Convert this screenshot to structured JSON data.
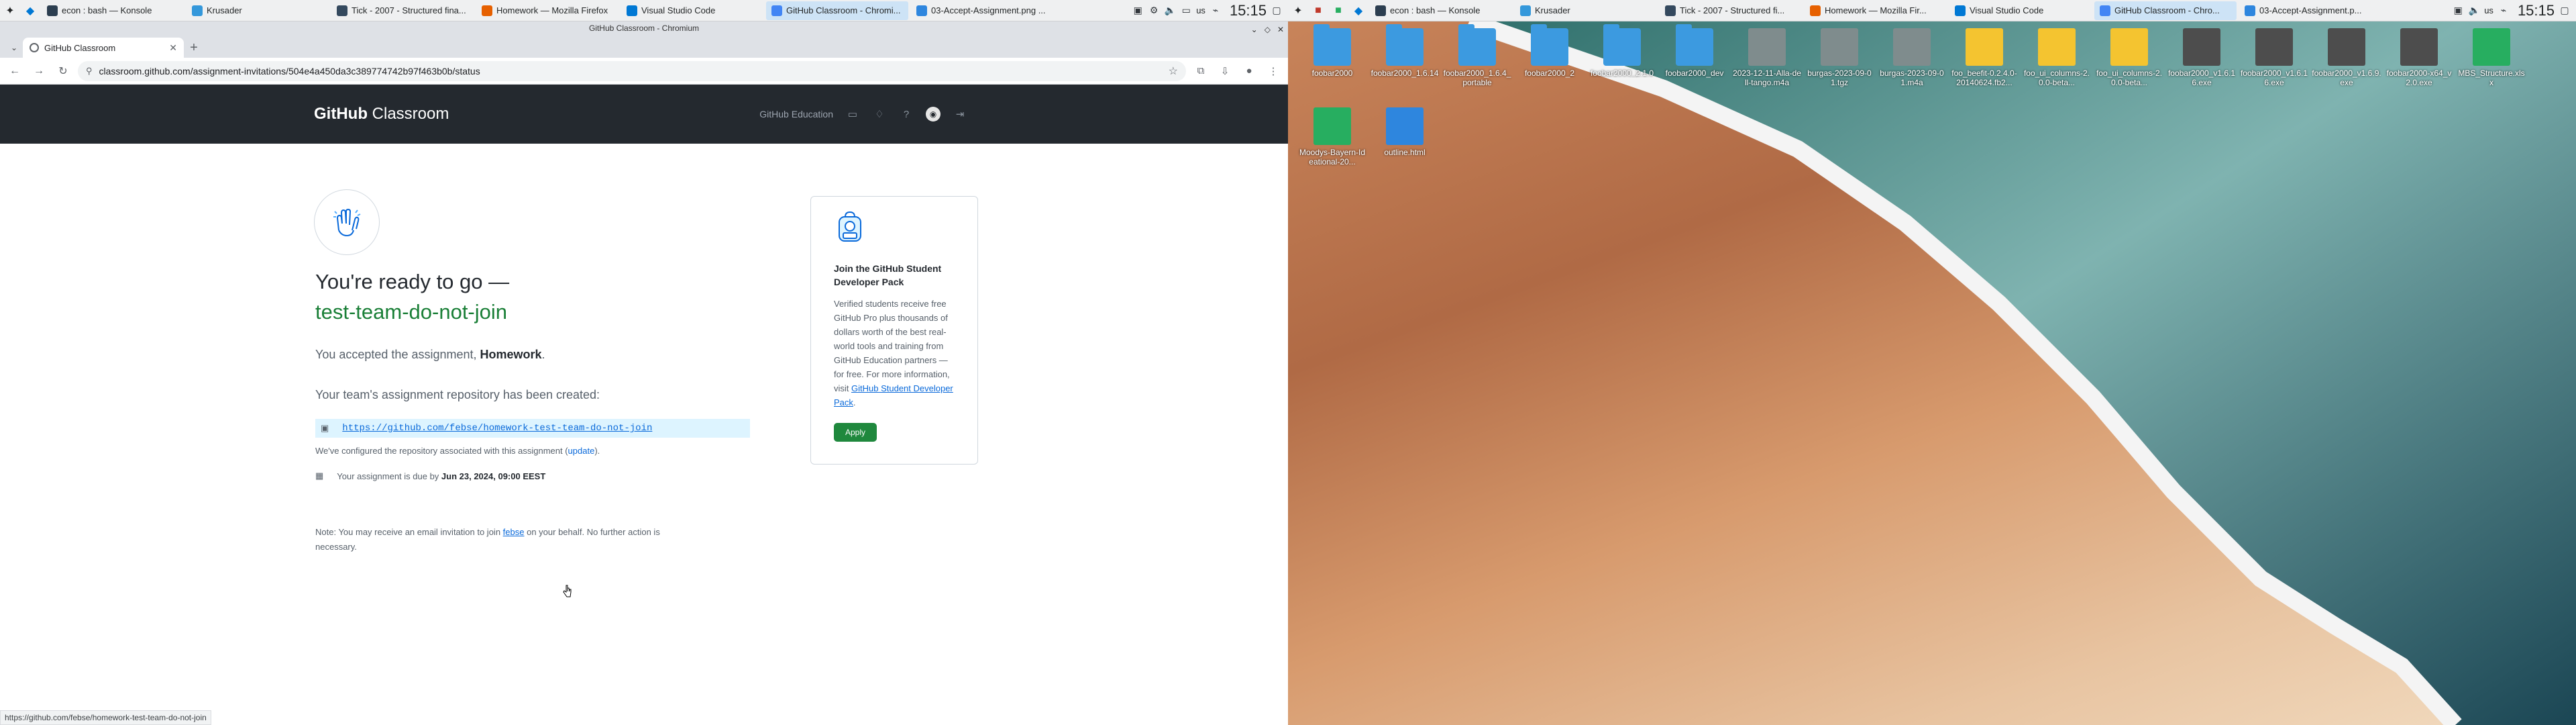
{
  "taskbar_left": {
    "tasks": [
      {
        "label": "econ : bash — Konsole",
        "active": false,
        "color": "#2c3e50"
      },
      {
        "label": "Krusader",
        "active": false,
        "color": "#3498db"
      },
      {
        "label": "Tick - 2007 - Structured fina...",
        "active": false,
        "color": "#34495e"
      },
      {
        "label": "Homework — Mozilla Firefox",
        "active": false,
        "color": "#e66000"
      },
      {
        "label": "Visual Studio Code",
        "active": false,
        "color": "#0078d4"
      },
      {
        "label": "GitHub Classroom - Chromi...",
        "active": true,
        "color": "#4285f4"
      },
      {
        "label": "03-Accept-Assignment.png ...",
        "active": false,
        "color": "#2e86de"
      }
    ],
    "keyboard": "us",
    "clock": "15:15"
  },
  "taskbar_right": {
    "tasks": [
      {
        "label": "econ : bash — Konsole",
        "active": false,
        "color": "#2c3e50"
      },
      {
        "label": "Krusader",
        "active": false,
        "color": "#3498db"
      },
      {
        "label": "Tick - 2007 - Structured fi...",
        "active": false,
        "color": "#34495e"
      },
      {
        "label": "Homework — Mozilla Fir...",
        "active": false,
        "color": "#e66000"
      },
      {
        "label": "Visual Studio Code",
        "active": false,
        "color": "#0078d4"
      },
      {
        "label": "GitHub Classroom - Chro...",
        "active": true,
        "color": "#4285f4"
      },
      {
        "label": "03-Accept-Assignment.p...",
        "active": false,
        "color": "#2e86de"
      }
    ],
    "keyboard": "us",
    "clock": "15:15"
  },
  "browser": {
    "window_title": "GitHub Classroom - Chromium",
    "tab_title": "GitHub Classroom",
    "url": "classroom.github.com/assignment-invitations/504e4a450da3c389774742b97f463b0b/status",
    "status_url": "https://github.com/febse/homework-test-team-do-not-join"
  },
  "page": {
    "brand_bold": "GitHub",
    "brand_rest": " Classroom",
    "nav_education": "GitHub Education",
    "title": "You're ready to go —",
    "team": "test-team-do-not-join",
    "accepted_prefix": "You accepted the assignment, ",
    "assignment": "Homework",
    "accepted_suffix": ".",
    "repo_created": "Your team's assignment repository has been created:",
    "repo_url": "https://github.com/febse/homework-test-team-do-not-join",
    "configured_prefix": "We've configured the repository associated with this assignment (",
    "configured_link": "update",
    "configured_suffix": ").",
    "due_prefix": "Your assignment is due by ",
    "due_date": "Jun 23, 2024, 09:00 EEST",
    "note_prefix": "Note: You may receive an email invitation to join ",
    "note_link": "febse",
    "note_suffix": " on your behalf. No further action is necessary."
  },
  "student_pack": {
    "title": "Join the GitHub Student Developer Pack",
    "body": "Verified students receive free GitHub Pro plus thousands of dollars worth of the best real-world tools and training from GitHub Education partners — for free. For more information, visit ",
    "link": "GitHub Student Developer Pack",
    "body_end": ".",
    "button": "Apply"
  },
  "desktop_icons": [
    {
      "name": "foobar2000",
      "kind": "folder"
    },
    {
      "name": "foobar2000_1.6.14",
      "kind": "folder"
    },
    {
      "name": "foobar2000_1.6.4_portable",
      "kind": "folder"
    },
    {
      "name": "foobar2000_2",
      "kind": "folder"
    },
    {
      "name": "foobar2000_2.1.0",
      "kind": "folder"
    },
    {
      "name": "foobar2000_dev",
      "kind": "folder"
    },
    {
      "name": "2023-12-11-Alla-dell-tango.m4a",
      "kind": "grey"
    },
    {
      "name": "burgas-2023-09-01.tgz",
      "kind": "grey"
    },
    {
      "name": "burgas-2023-09-01.m4a",
      "kind": "grey"
    },
    {
      "name": "foo_beefit-0.2.4.0-20140624.fb2...",
      "kind": "yellow"
    },
    {
      "name": "foo_ui_columns-2.0.0-beta...",
      "kind": "yellow"
    },
    {
      "name": "foo_ui_columns-2.0.0-beta...",
      "kind": "yellow"
    },
    {
      "name": "foobar2000_v1.6.16.exe",
      "kind": "dark"
    },
    {
      "name": "foobar2000_v1.6.16.exe",
      "kind": "dark"
    },
    {
      "name": "foobar2000_v1.6.9.exe",
      "kind": "dark"
    },
    {
      "name": "foobar2000-x64_v2.0.exe",
      "kind": "dark"
    },
    {
      "name": "MBS_Structure.xlsx",
      "kind": "green"
    },
    {
      "name": "Moodys-Bayern-Ideational-20...",
      "kind": "green"
    },
    {
      "name": "outline.html",
      "kind": "blue"
    }
  ]
}
